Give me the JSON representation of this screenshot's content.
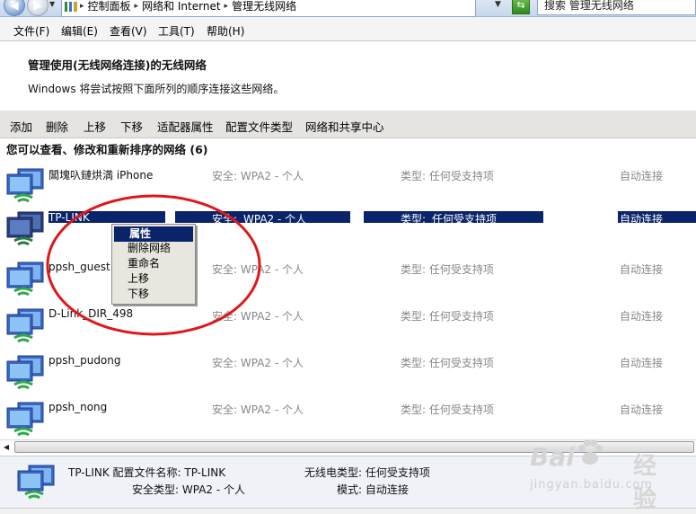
{
  "address_bar": {
    "crumbs": [
      "控制面板",
      "网络和 Internet",
      "管理无线网络"
    ],
    "search_placeholder": "搜索 管理无线网络"
  },
  "menu": [
    "文件(F)",
    "编辑(E)",
    "查看(V)",
    "工具(T)",
    "帮助(H)"
  ],
  "heading": "管理使用(无线网络连接)的无线网络",
  "subtext": "Windows 将尝试按照下面所列的顺序连接这些网络。",
  "toolbar": [
    "添加",
    "删除",
    "上移",
    "下移",
    "适配器属性",
    "配置文件类型",
    "网络和共享中心"
  ],
  "list_title": "您可以查看、修改和重新排序的网络 (6)",
  "networks": [
    {
      "name": "閶塊叺鏈烘満 iPhone",
      "security": "安全: WPA2 - 个人",
      "type": "类型: 任何受支持项",
      "mode": "自动连接"
    },
    {
      "name": "TP-LINK",
      "security_label": "安全:",
      "security_value": "WPA2 - 个人",
      "type_label": "类型:",
      "type_value": "任何受支持项",
      "mode": "自动连接",
      "selected": true
    },
    {
      "name": "ppsh_guest",
      "security": "安全: WPA2 - 个人",
      "type": "类型: 任何受支持项",
      "mode": "自动连接"
    },
    {
      "name": "D-Link_DIR_498",
      "security": "安全: WPA2 - 个人",
      "type": "类型: 任何受支持项",
      "mode": "自动连接"
    },
    {
      "name": "ppsh_pudong",
      "security": "安全: WPA2 - 个人",
      "type": "类型: 任何受支持项",
      "mode": "自动连接"
    },
    {
      "name": "ppsh_nong",
      "security": "安全: WPA2 - 个人",
      "type": "类型: 任何受支持项",
      "mode": "自动连接"
    }
  ],
  "context_menu": [
    "属性",
    "删除网络",
    "重命名",
    "上移",
    "下移"
  ],
  "details": {
    "profile": "TP-LINK 配置文件名称: TP-LINK",
    "security_type": "安全类型: WPA2 - 个人",
    "radio_type": "无线电类型: 任何受支持项",
    "mode": "模式: 自动连接"
  },
  "watermark": {
    "logo_left": "Bai",
    "logo_right": "经验",
    "url": "jingyan.baidu.com"
  },
  "colors": {
    "selection": "#0a246a",
    "annotation": "#e0161b",
    "toolbar_bg": "#e6e4e1"
  }
}
